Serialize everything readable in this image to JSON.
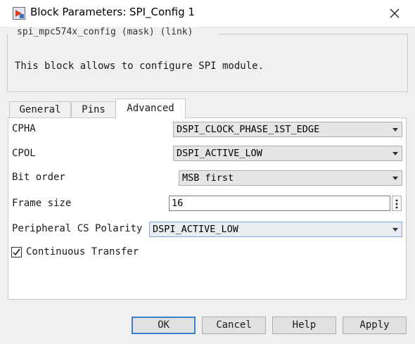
{
  "window": {
    "title": "Block Parameters: SPI_Config 1"
  },
  "mask": {
    "legend": "spi_mpc574x_config (mask) (link)",
    "description": "This block allows to configure SPI module."
  },
  "tabs": [
    {
      "label": "General",
      "active": false
    },
    {
      "label": "Pins",
      "active": false
    },
    {
      "label": "Advanced",
      "active": true
    }
  ],
  "params": {
    "cpha": {
      "label": "CPHA",
      "value": "DSPI_CLOCK_PHASE_1ST_EDGE"
    },
    "cpol": {
      "label": "CPOL",
      "value": "DSPI_ACTIVE_LOW"
    },
    "bit_order": {
      "label": "Bit order",
      "value": "MSB first"
    },
    "frame_size": {
      "label": "Frame size",
      "value": "16"
    },
    "cs_polarity": {
      "label": "Peripheral CS Polarity",
      "value": "DSPI_ACTIVE_LOW"
    },
    "continuous": {
      "label": "Continuous Transfer",
      "checked": true
    }
  },
  "buttons": {
    "ok": "OK",
    "cancel": "Cancel",
    "help": "Help",
    "apply": "Apply"
  },
  "icons": {
    "app": "simulink-block-icon",
    "close": "close-icon",
    "more": "vertical-ellipsis-icon",
    "check": "checkmark-icon"
  },
  "colors": {
    "focus_border": "#7aa7d6",
    "default_button_border": "#3c7fd1"
  }
}
